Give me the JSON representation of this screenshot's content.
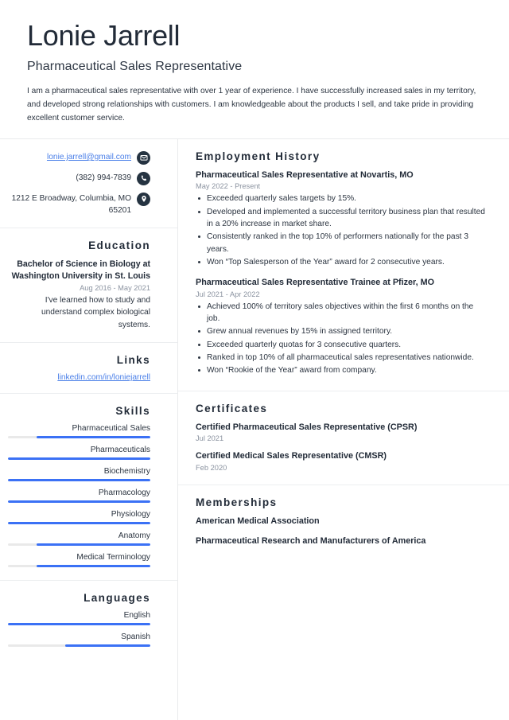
{
  "theme": {
    "accent_blue": "#3b71f5",
    "link_blue": "#4a7fe8",
    "icon_dark": "#253341",
    "text_dark": "#222b38",
    "text_muted": "#8b93a0",
    "track_gray": "#e9e9e9",
    "rule_gray": "#eceef0"
  },
  "header": {
    "full_name": "Lonie Jarrell",
    "job_title": "Pharmaceutical Sales Representative",
    "summary": "I am a pharmaceutical sales representative with over 1 year of experience. I have successfully increased sales in my territory, and developed strong relationships with customers. I am knowledgeable about the products I sell, and take pride in providing excellent customer service."
  },
  "contact": {
    "email": "lonie.jarrell@gmail.com",
    "email_icon": "envelope-icon",
    "phone": "(382) 994-7839",
    "phone_icon": "phone-icon",
    "address": "1212 E Broadway, Columbia, MO 65201",
    "address_icon": "location-pin-icon"
  },
  "education": {
    "heading": "Education",
    "items": [
      {
        "degree": "Bachelor of Science in Biology at Washington University in St. Louis",
        "date": "Aug 2016 - May 2021",
        "description": "I've learned how to study and understand complex biological systems."
      }
    ]
  },
  "links": {
    "heading": "Links",
    "items": [
      {
        "label": "linkedin.com/in/loniejarrell"
      }
    ]
  },
  "skills": {
    "heading": "Skills",
    "items": [
      {
        "label": "Pharmaceutical Sales",
        "level": 80
      },
      {
        "label": "Pharmaceuticals",
        "level": 100
      },
      {
        "label": "Biochemistry",
        "level": 100
      },
      {
        "label": "Pharmacology",
        "level": 100
      },
      {
        "label": "Physiology",
        "level": 100
      },
      {
        "label": "Anatomy",
        "level": 80
      },
      {
        "label": "Medical Terminology",
        "level": 80
      }
    ]
  },
  "languages": {
    "heading": "Languages",
    "items": [
      {
        "label": "English",
        "level": 100
      },
      {
        "label": "Spanish",
        "level": 60
      }
    ]
  },
  "employment": {
    "heading": "Employment History",
    "jobs": [
      {
        "title": "Pharmaceutical Sales Representative at Novartis, MO",
        "date": "May 2022 - Present",
        "bullets": [
          "Exceeded quarterly sales targets by 15%.",
          "Developed and implemented a successful territory business plan that resulted in a 20% increase in market share.",
          "Consistently ranked in the top 10% of performers nationally for the past 3 years.",
          "Won “Top Salesperson of the Year” award for 2 consecutive years."
        ]
      },
      {
        "title": "Pharmaceutical Sales Representative Trainee at Pfizer, MO",
        "date": "Jul 2021 - Apr 2022",
        "bullets": [
          "Achieved 100% of territory sales objectives within the first 6 months on the job.",
          "Grew annual revenues by 15% in assigned territory.",
          "Exceeded quarterly quotas for 3 consecutive quarters.",
          "Ranked in top 10% of all pharmaceutical sales representatives nationwide.",
          "Won “Rookie of the Year” award from company."
        ]
      }
    ]
  },
  "certificates": {
    "heading": "Certificates",
    "items": [
      {
        "name": "Certified Pharmaceutical Sales Representative (CPSR)",
        "date": "Jul 2021"
      },
      {
        "name": "Certified Medical Sales Representative (CMSR)",
        "date": "Feb 2020"
      }
    ]
  },
  "memberships": {
    "heading": "Memberships",
    "items": [
      {
        "name": "American Medical Association"
      },
      {
        "name": "Pharmaceutical Research and Manufacturers of America"
      }
    ]
  }
}
